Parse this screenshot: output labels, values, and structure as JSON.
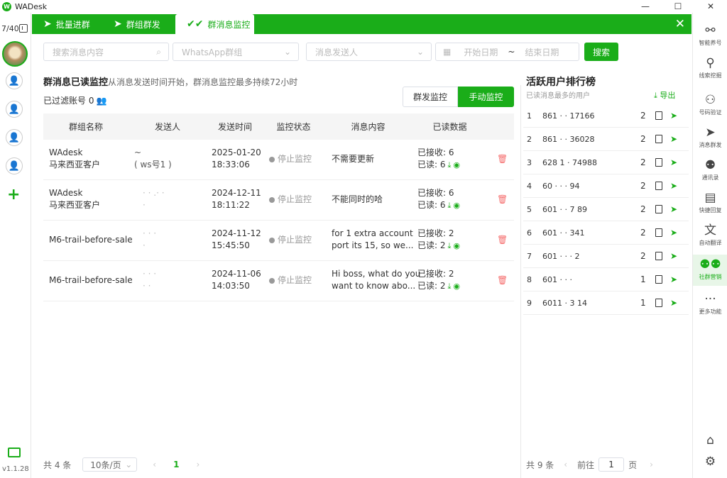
{
  "app": {
    "title": "WADesk",
    "logo": "W",
    "account_count": "7/40",
    "version": "v1.1.28"
  },
  "tabs": [
    {
      "label": "批量进群",
      "icon": "send-icon",
      "active": false
    },
    {
      "label": "群组群发",
      "icon": "send-icon",
      "active": false
    },
    {
      "label": "群消息监控",
      "icon": "double-check-icon",
      "active": true
    }
  ],
  "filters": {
    "search_placeholder": "搜索消息内容",
    "group_placeholder": "WhatsApp群组",
    "sender_placeholder": "消息发送人",
    "start_date_placeholder": "开始日期",
    "date_sep": "~",
    "end_date_placeholder": "结束日期",
    "search_button": "搜索"
  },
  "monitor": {
    "title": "群消息已读监控",
    "description": "从消息发送时间开始，群消息监控最多持续72小时",
    "filtered_label": "已过滤账号 0",
    "toggle": [
      "群发监控",
      "手动监控"
    ],
    "toggle_active": "手动监控"
  },
  "table": {
    "columns": [
      "群组名称",
      "发送人",
      "发送时间",
      "监控状态",
      "消息内容",
      "已读数据"
    ],
    "rows": [
      {
        "group": [
          "WAdesk",
          "马来西亚客户"
        ],
        "sender": [
          "~",
          "( ws号1 )"
        ],
        "time": [
          "2025-01-20",
          "18:33:06"
        ],
        "status": "停止监控",
        "content": [
          "不需要更新"
        ],
        "received": "已接收: 6",
        "read": "已读: 6"
      },
      {
        "group": [
          "WAdesk",
          "马来西亚客户"
        ],
        "sender": [
          "·  ·  .· ·",
          "·"
        ],
        "time": [
          "2024-12-11",
          "18:11:22"
        ],
        "status": "停止监控",
        "content": [
          "不能同时的哈"
        ],
        "received": "已接收: 6",
        "read": "已读: 6"
      },
      {
        "group": [
          "M6-trail-before-sale"
        ],
        "sender": [
          "·  ·  ·",
          "·"
        ],
        "time": [
          "2024-11-12",
          "15:45:50"
        ],
        "status": "停止监控",
        "content": [
          "for 1 extra account",
          "port its 15, so we..."
        ],
        "received": "已接收: 2",
        "read": "已读: 2"
      },
      {
        "group": [
          "M6-trail-before-sale"
        ],
        "sender": [
          "·  ·  ·",
          "· ·"
        ],
        "time": [
          "2024-11-06",
          "14:03:50"
        ],
        "status": "停止监控",
        "content": [
          "Hi boss, what do you",
          "want to know abo..."
        ],
        "received": "已接收: 2",
        "read": "已读: 2"
      }
    ]
  },
  "pagination": {
    "total": "共 4 条",
    "page_size": "10条/页",
    "current_page": "1"
  },
  "ranking": {
    "title": "活跃用户排行榜",
    "subtitle": "已读消息最多的用户",
    "export": "导出",
    "rows": [
      {
        "rank": "1",
        "number": "861 · · 17166",
        "count": "2"
      },
      {
        "rank": "2",
        "number": "861 · · 36028",
        "count": "2"
      },
      {
        "rank": "3",
        "number": "628 1 · 74988",
        "count": "2"
      },
      {
        "rank": "4",
        "number": "60 · · · 94",
        "count": "2"
      },
      {
        "rank": "5",
        "number": "601 · · 7 89",
        "count": "2"
      },
      {
        "rank": "6",
        "number": "601 · · 341",
        "count": "2"
      },
      {
        "rank": "7",
        "number": "601 · · · 2",
        "count": "2"
      },
      {
        "rank": "8",
        "number": "601 · · ·",
        "count": "1"
      },
      {
        "rank": "9",
        "number": "6011 · 3 14",
        "count": "1"
      }
    ],
    "footer_total": "共 9 条",
    "goto_label": "前往",
    "goto_page": "1",
    "page_suffix": "页"
  },
  "right_sidebar": [
    {
      "label": "智能养号",
      "icon": "share-nodes-icon"
    },
    {
      "label": "线索挖掘",
      "icon": "person-pin-icon"
    },
    {
      "label": "号码验证",
      "icon": "user-search-icon"
    },
    {
      "label": "消息群发",
      "icon": "send-icon"
    },
    {
      "label": "通讯录",
      "icon": "contacts-icon"
    },
    {
      "label": "快捷回复",
      "icon": "chat-icon"
    },
    {
      "label": "自动翻译",
      "icon": "translate-icon"
    },
    {
      "label": "社群营销",
      "icon": "community-icon",
      "active": true
    },
    {
      "label": "更多功能",
      "icon": "more-icon"
    }
  ],
  "colors": {
    "brand": "#1aad19",
    "danger": "#f56c6c"
  }
}
